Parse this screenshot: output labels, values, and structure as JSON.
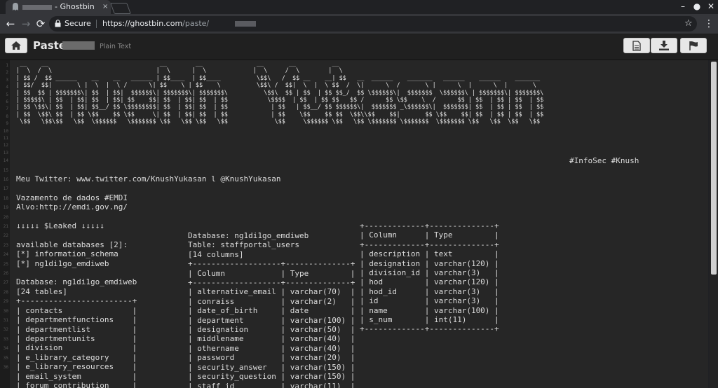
{
  "browser": {
    "tab": {
      "title": "- Ghostbin",
      "close": "×"
    },
    "window": {
      "account": "●",
      "minimize": "–",
      "maximize": "☐",
      "close": "✕"
    },
    "nav": {
      "back": "←",
      "forward": "→",
      "reload": "⟳"
    },
    "address": {
      "secure_label": "Secure",
      "url_prefix": "https://ghostbin.com",
      "url_path": "/paste/",
      "star": "☆",
      "menu": "⋮"
    }
  },
  "header": {
    "title": "Paste",
    "syntax": "Plain Text"
  },
  "paste": {
    "banner": " __    __                               __        __               __       __          __\n|  \\  /  \\                             |  \\      |  \\             |  \\     /  \\        |  \\\n| $$ /  $$ ______    __    __   ______ | $$____  | $$____          \\$$\\   /  $$ __    __| $$   __  ______    _______   ______    ______    _______\n| $$/  $$|       \\ |  \\  |  \\ /      \\| $$    \\ | $$    \\          \\$$\\ /  $$|  \\  |  \\ $$  /  \\|      \\  /       \\ |      \\  |      \\  |       \\\n| $$  $$ | $$$$$$$\\| $$  | $$|  $$$$$$\\| $$$$$$$\\| $$$$$$$\\          \\$$\\  $$ | $$  | $$ $$_/  $$ \\$$$$$$\\|  $$$$$$$  \\$$$$$$\\ | $$$$$$$\\| $$$$$$$\\\n| $$$$$\\ | $$  | $$| $$  | $$| $$    $$| $$  | $$| $$  | $$           \\$$$$  | $$  | $$ $$   $$ /      $$ \\$$    \\  /      $$ | $$  | $$ | $$  | $$\n| $$ \\$$\\| $$  | $$| $$__/ $$ \\$$$$$$$$| $$  | $$| $$  | $$            | $$   | $$__/ $$ $$$$$$\\|  $$$$$$$ _\\$$$$$$\\|  $$$$$$$| $$  | $$ | $$  | $$\n| $$  \\$$\\ $$  | $$ \\$$    $$ \\$$     \\| $$  | $$| $$  | $$            | $$    \\$$    $$ $$  \\$$\\\\$$    $$|       $$ \\$$    $$| $$  | $$ | $$  | $$\n \\$$   \\$$\\$$   \\$$  \\$$$$$$   \\$$$$$$$ \\$$   \\$$ \\$$   \\$$             \\$$     \\$$$$$$ \\$$   \\$$ \\$$$$$$$ \\$$$$$$$  \\$$$$$$$ \\$$   \\$$  \\$$   \\$$",
    "tags": "#InfoSec #Knush",
    "left": "Meu Twitter: www.twitter.com/KnushYukasan l @KnushYukasan\n\nVazamento de dados #EMDI\nAlvo:http://emdi.gov.ng/\n\n↓↓↓↓↓ $Leaked ↓↓↓↓↓\n\navailable databases [2]:\n[*] information_schema\n[*] ng1di1go_emdiweb\n\nDatabase: ng1di1go_emdiweb\n[24 tables]\n+------------------------+\n| contacts               |\n| departmentfunctions    |\n| departmentlist         |\n| departmentunits        |\n| division               |\n| e_library_category     |\n| e_library_resources    |\n| email_system           |\n| forum_contribution     |",
    "middle": "Database: ng1di1go_emdiweb\nTable: staffportal_users\n[14 columns]\n+-------------------+--------------+\n| Column            | Type         |\n+-------------------+--------------+\n| alternative_email | varchar(70)  |\n| conraiss          | varchar(2)   |\n| date_of_birth     | date         |\n| department        | varchar(100) |\n| designation       | varchar(50)  |\n| middlename        | varchar(40)  |\n| othername         | varchar(40)  |\n| password          | varchar(20)  |\n| security_answer   | varchar(150) |\n| security_question | varchar(150) |\n| staff_id          | varchar(11)  |",
    "right": "+-------------+--------------+\n| Column      | Type         |\n+-------------+--------------+\n| description | text         |\n| designation | varchar(120) |\n| division_id | varchar(3)   |\n| hod         | varchar(120) |\n| hod_id      | varchar(3)   |\n| id          | varchar(3)   |\n| name        | varchar(100) |\n| s_num       | int(11)      |\n+-------------+--------------+"
  }
}
